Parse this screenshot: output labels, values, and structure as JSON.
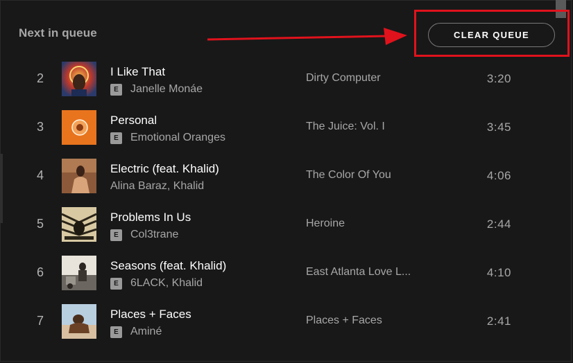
{
  "queue": {
    "title": "Next in queue",
    "clear_label": "CLEAR QUEUE",
    "highlight_color": "#e0121c"
  },
  "tracks": [
    {
      "num": "2",
      "title": "I Like That",
      "explicit": true,
      "explicit_label": "E",
      "artist": "Janelle Monáe",
      "album": "Dirty Computer",
      "duration": "3:20"
    },
    {
      "num": "3",
      "title": "Personal",
      "explicit": true,
      "explicit_label": "E",
      "artist": "Emotional Oranges",
      "album": "The Juice: Vol. I",
      "duration": "3:45"
    },
    {
      "num": "4",
      "title": "Electric (feat. Khalid)",
      "explicit": false,
      "explicit_label": "",
      "artist": "Alina Baraz, Khalid",
      "album": "The Color Of You",
      "duration": "4:06"
    },
    {
      "num": "5",
      "title": "Problems In Us",
      "explicit": true,
      "explicit_label": "E",
      "artist": "Col3trane",
      "album": "Heroine",
      "duration": "2:44"
    },
    {
      "num": "6",
      "title": "Seasons (feat. Khalid)",
      "explicit": true,
      "explicit_label": "E",
      "artist": "6LACK, Khalid",
      "album": "East Atlanta Love L...",
      "duration": "4:10"
    },
    {
      "num": "7",
      "title": "Places + Faces",
      "explicit": true,
      "explicit_label": "E",
      "artist": "Aminé",
      "album": "Places + Faces",
      "duration": "2:41"
    }
  ]
}
